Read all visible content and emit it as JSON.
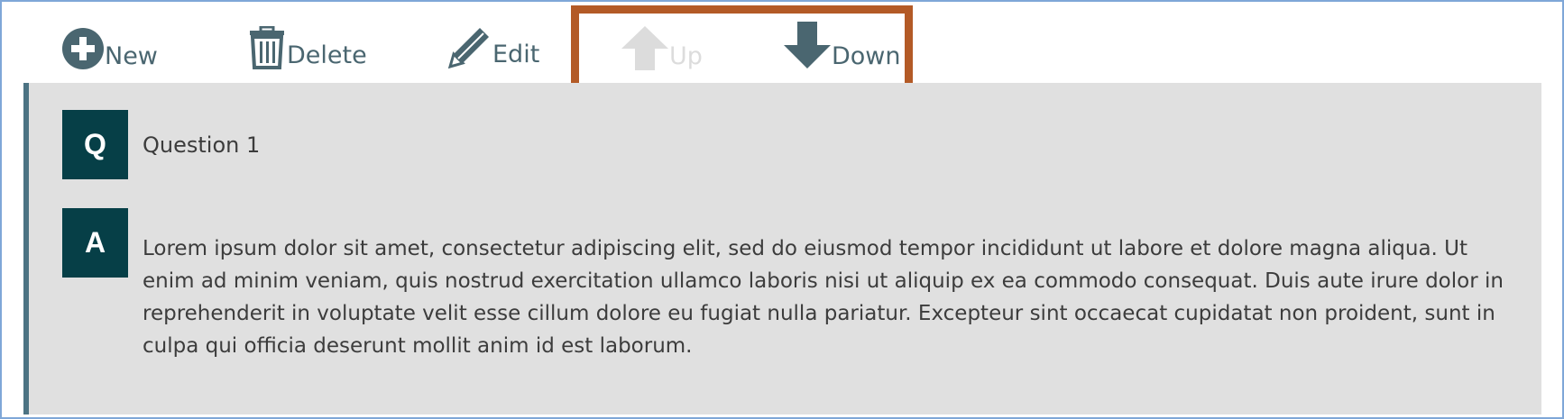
{
  "toolbar": {
    "new_label": "New",
    "delete_label": "Delete",
    "edit_label": "Edit",
    "up_label": "Up",
    "down_label": "Down",
    "icons": {
      "new": "plus-circle-icon",
      "delete": "trash-icon",
      "edit": "pencil-icon",
      "up": "arrow-up-icon",
      "down": "arrow-down-icon"
    },
    "up_disabled": true
  },
  "qa": {
    "question_badge": "Q",
    "question_text": "Question 1",
    "answer_badge": "A",
    "answer_text": "Lorem ipsum dolor sit amet, consectetur adipiscing elit, sed do eiusmod tempor incididunt ut labore et dolore magna aliqua. Ut enim ad minim veniam, quis nostrud exercitation ullamco laboris nisi ut aliquip ex ea commodo consequat. Duis aute irure dolor in reprehenderit in voluptate velit esse cillum dolore eu fugiat nulla pariatur. Excepteur sint occaecat cupidatat non proident, sunt in culpa qui officia deserunt mollit anim id est laborum."
  },
  "colors": {
    "icon": "#4a6670",
    "disabled": "#dcdcdc",
    "highlight": "#b35a26",
    "badge": "#063f47",
    "panel": "#e0e0e0",
    "panel_border": "#4c7383",
    "frame_border": "#7fa7d8"
  }
}
